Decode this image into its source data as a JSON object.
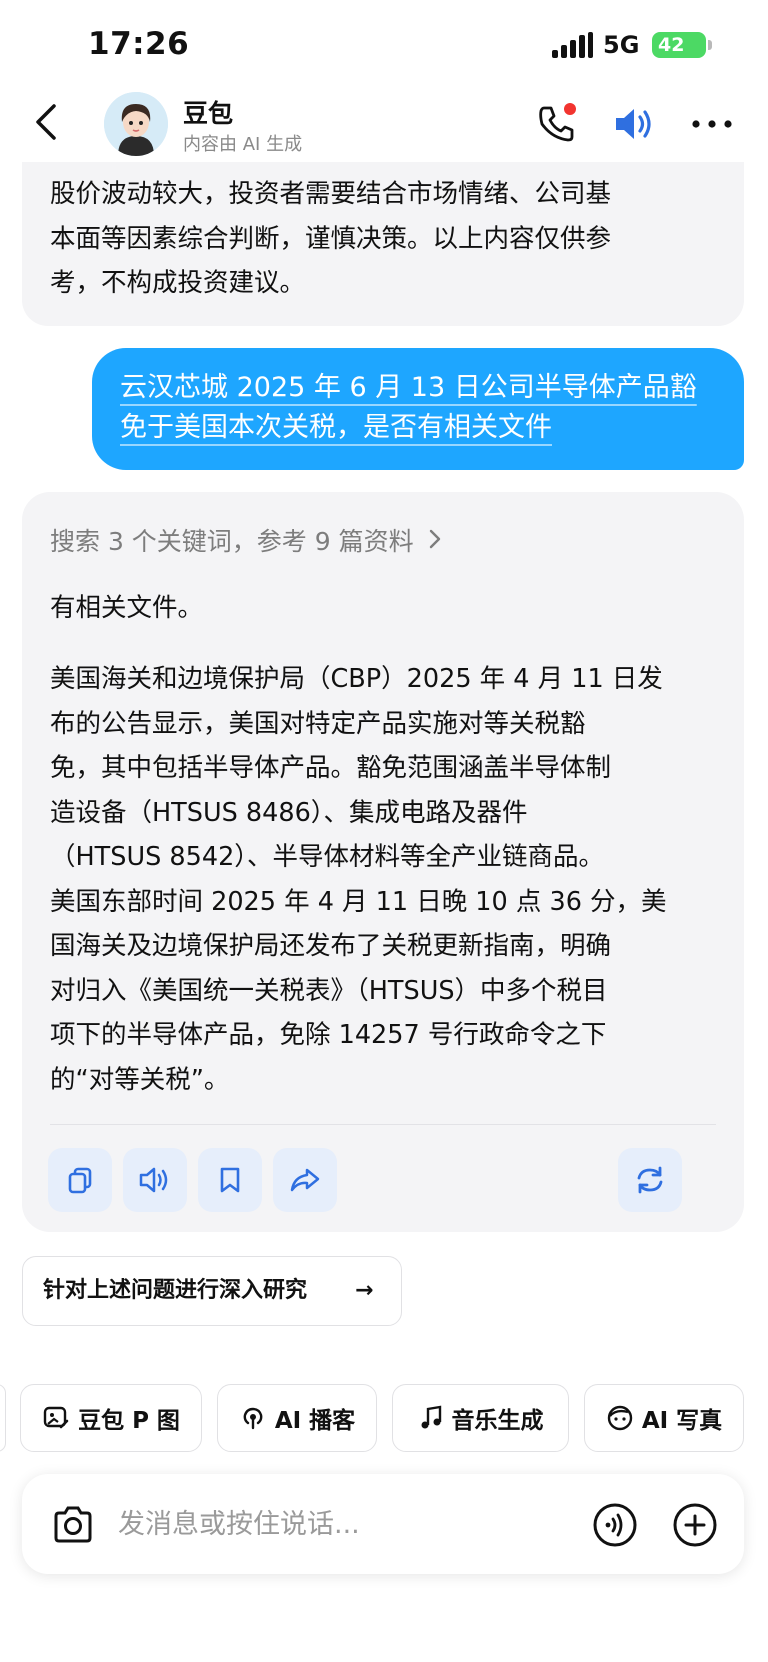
{
  "status_bar": {
    "time": "17:26",
    "network": "5G",
    "battery": "42"
  },
  "header": {
    "title": "豆包",
    "subtitle": "内容由 AI 生成"
  },
  "previous_answer": {
    "lines": [
      "股价波动较大，投资者需要结合市场情绪、公司基",
      "本面等因素综合判断，谨慎决策。以上内容仅供参",
      "考，不构成投资建议。"
    ]
  },
  "user_message": {
    "lines": [
      "云汉芯城 2025 年 6 月 13 日公司半导体产品豁",
      "免于美国本次关税，是否有相关文件"
    ]
  },
  "answer": {
    "search_ref": "搜索 3 个关键词，参考 9 篇资料",
    "summary": "有相关文件。",
    "body_lines": [
      "美国海关和边境保护局（CBP）2025 年 4 月 11 日发",
      "布的公告显示，美国对特定产品实施对等关税豁",
      "免，其中包括半导体产品。豁免范围涵盖半导体制",
      "造设备（HTSUS 8486）、集成电路及器件",
      "（HTSUS 8542）、半导体材料等全产业链商品。",
      "美国东部时间 2025 年 4 月 11 日晚 10 点 36 分，美",
      "国海关及边境保护局还发布了关税更新指南，明确",
      "对归入《美国统一关税表》（HTSUS）中多个税目",
      "项下的半导体产品，免除 14257 号行政命令之下",
      "的“对等关税”。"
    ]
  },
  "deep_research": {
    "label": "针对上述问题进行深入研究",
    "arrow": "→"
  },
  "chips": [
    {
      "label": "豆包 P 图",
      "icon": "image-edit-icon"
    },
    {
      "label": "AI 播客",
      "icon": "podcast-icon"
    },
    {
      "label": "音乐生成",
      "icon": "music-note-icon"
    },
    {
      "label": "AI 写真",
      "icon": "face-icon"
    }
  ],
  "input": {
    "placeholder": "发消息或按住说话..."
  },
  "colors": {
    "accent": "#1ea6ff",
    "bubble": "#f4f4f6",
    "action_bg": "#e6eefb",
    "icon_blue": "#2f6fe0"
  }
}
